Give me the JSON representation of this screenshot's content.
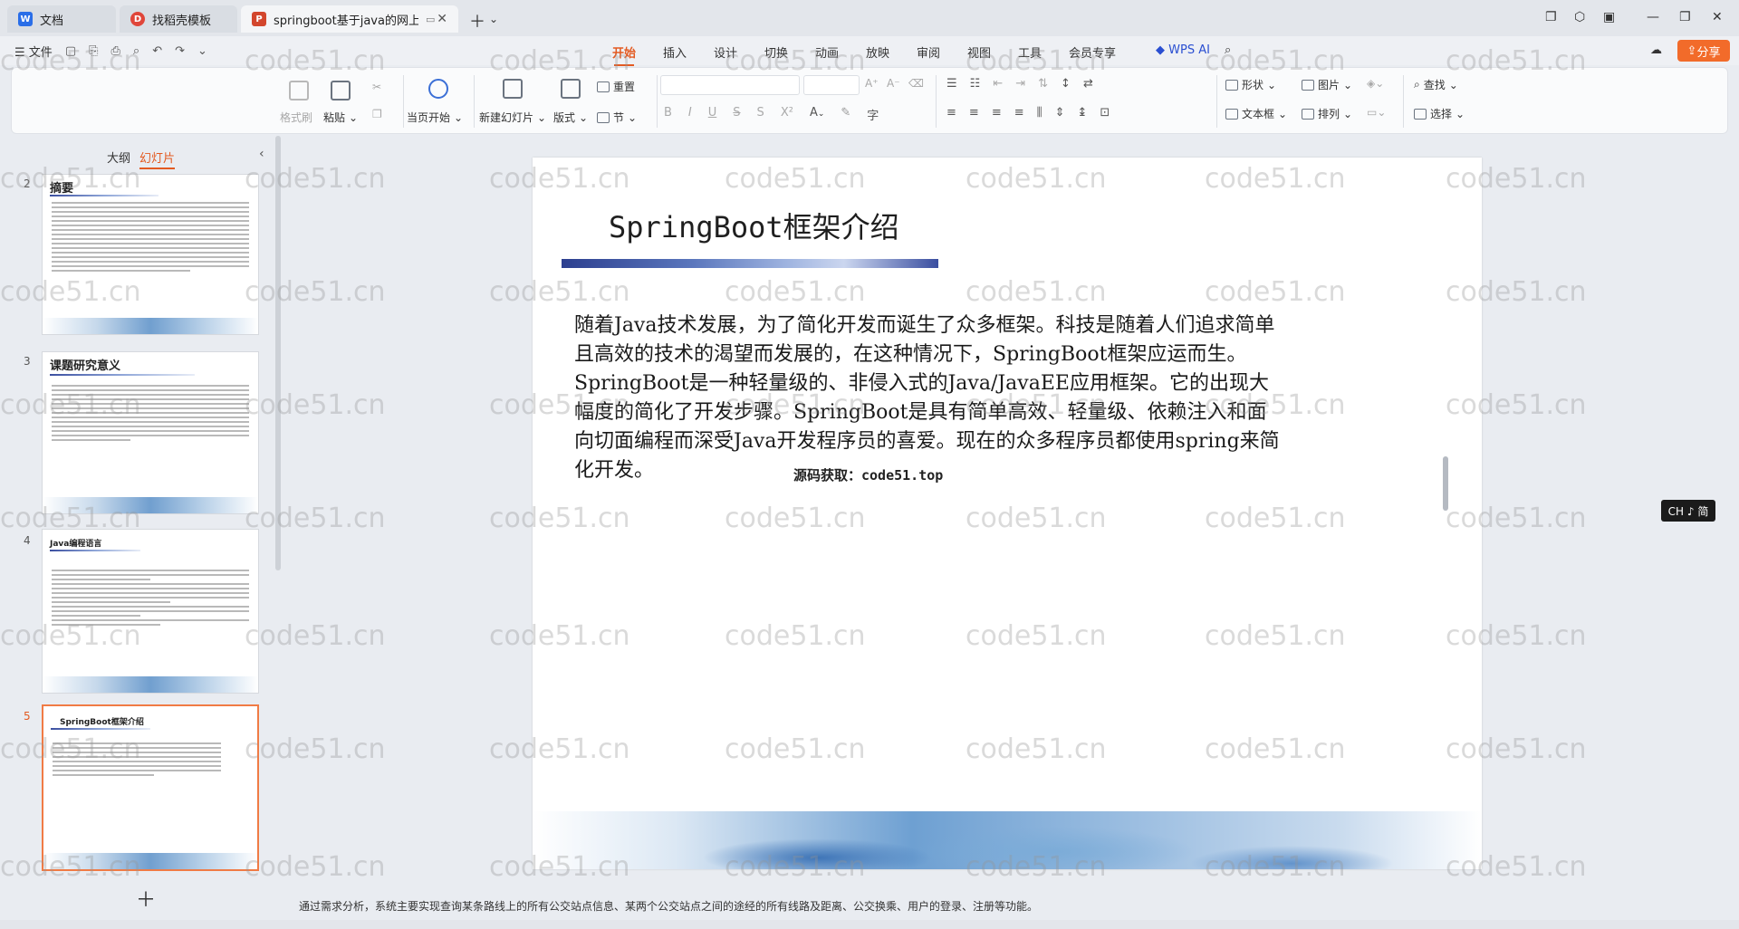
{
  "titlebar": {
    "tabs": [
      {
        "label": "文档"
      },
      {
        "label": "找稻壳模板"
      },
      {
        "label": "springboot基于java的网上"
      }
    ]
  },
  "menu": {
    "file_label": "文件",
    "tabs": [
      "开始",
      "插入",
      "设计",
      "切换",
      "动画",
      "放映",
      "审阅",
      "视图",
      "工具",
      "会员专享"
    ],
    "wps_ai": "WPS AI",
    "share": "分享"
  },
  "ribbon": {
    "format_painter": "格式刷",
    "paste": "粘贴",
    "from_current": "当页开始",
    "new_slide": "新建幻灯片",
    "layout": "版式",
    "section": "节",
    "reset": "重置",
    "shape": "形状",
    "picture": "图片",
    "textbox": "文本框",
    "arrange": "排列",
    "find": "查找",
    "select": "选择"
  },
  "left_panel": {
    "tab_outline": "大纲",
    "tab_slides": "幻灯片",
    "thumbnails": [
      {
        "num": "2",
        "title": "摘要"
      },
      {
        "num": "3",
        "title": "课题研究意义"
      },
      {
        "num": "4",
        "title": "Java编程语言"
      },
      {
        "num": "5",
        "title": "SpringBoot框架介绍"
      }
    ]
  },
  "slide": {
    "title": "SpringBoot框架介绍",
    "paragraphs": [
      "随着Java技术发展，为了简化开发而诞生了众多框架。科技是随着人们追求简单且高效的技术的渴望而发展的，在这种情况下，SpringBoot框架应运而生。",
      "SpringBoot是一种轻量级的、非侵入式的Java/JavaEE应用框架。它的出现大幅度的简化了开发步骤。SpringBoot是具有简单高效、轻量级、依赖注入和面向切面编程而深受Java开发程序员的喜爱。现在的众多程序员都使用spring来简化开发。"
    ],
    "overlay_text": "源码获取：code51.top"
  },
  "notes": "通过需求分析，系统主要实现查询某条路线上的所有公交站点信息、某两个公交站点之间的途经的所有线路及距离、公交换乘、用户的登录、注册等功能。",
  "ime": "CH ♪ 简",
  "watermark": "code51.cn"
}
